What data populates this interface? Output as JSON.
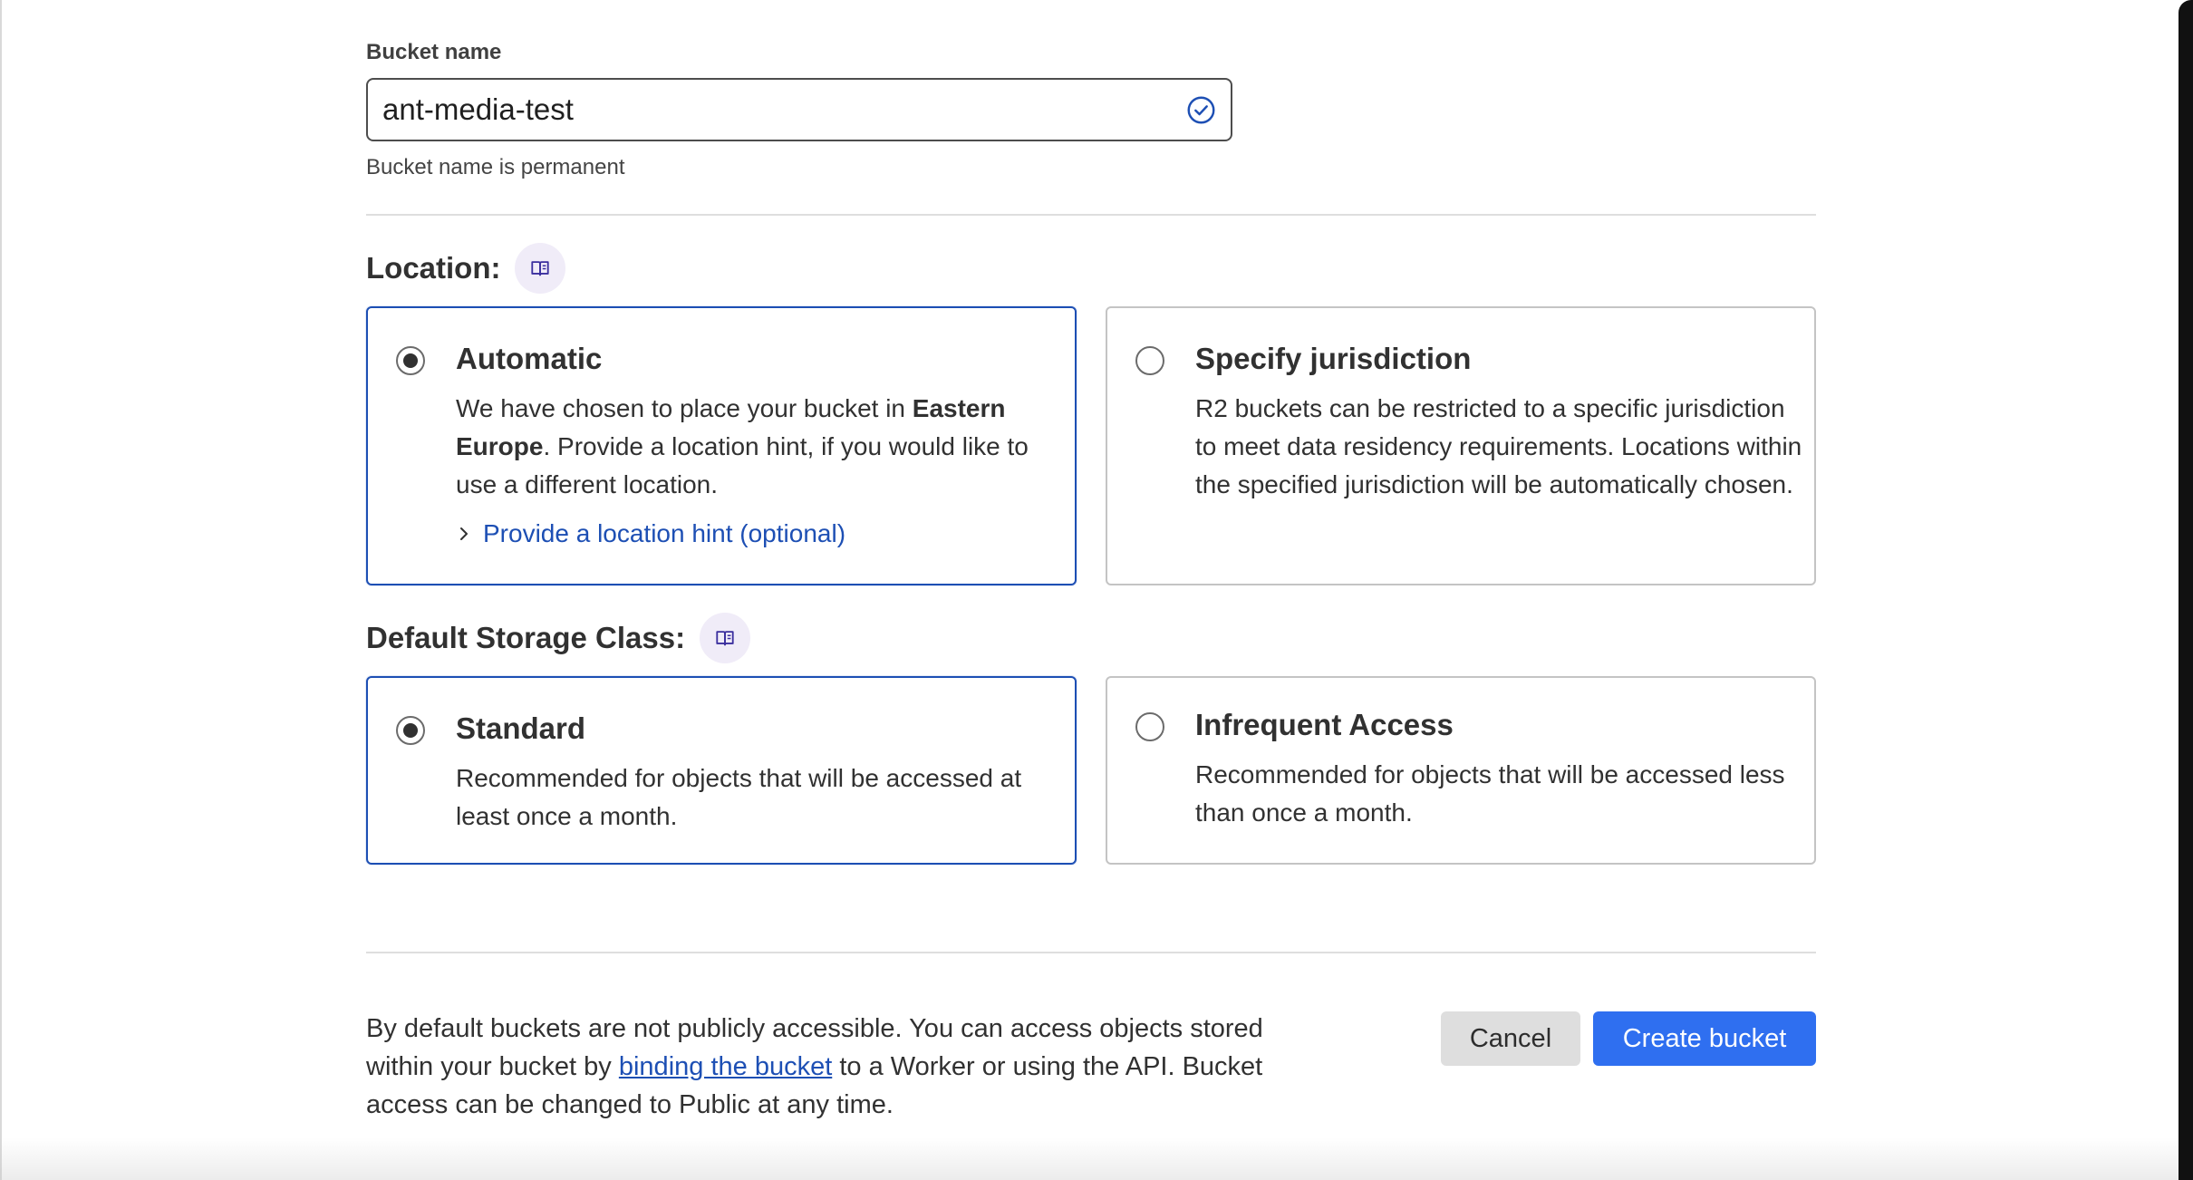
{
  "bucket_name": {
    "label": "Bucket name",
    "value": "ant-media-test",
    "helper": "Bucket name is permanent",
    "valid_icon": "check-circle-icon"
  },
  "location": {
    "title": "Location:",
    "docs_icon": "book-icon",
    "options": [
      {
        "title": "Automatic",
        "selected": true,
        "desc_before": "We have chosen to place your bucket in ",
        "desc_bold": "Eastern Europe",
        "desc_after": ". Provide a location hint, if you would like to use a different location.",
        "hint_link": "Provide a location hint (optional)"
      },
      {
        "title": "Specify jurisdiction",
        "selected": false,
        "desc": "R2 buckets can be restricted to a specific jurisdiction to meet data residency requirements. Locations within the specified jurisdiction will be automatically chosen."
      }
    ]
  },
  "storage_class": {
    "title": "Default Storage Class:",
    "docs_icon": "book-icon",
    "options": [
      {
        "title": "Standard",
        "selected": true,
        "desc": "Recommended for objects that will be accessed at least once a month."
      },
      {
        "title": "Infrequent Access",
        "selected": false,
        "desc": "Recommended for objects that will be accessed less than once a month."
      }
    ]
  },
  "footer": {
    "text_before": "By default buckets are not publicly accessible. You can access objects stored within your bucket by ",
    "link": "binding the bucket",
    "text_after": " to a Worker or using the API. Bucket access can be changed to Public at any time.",
    "cancel_label": "Cancel",
    "create_label": "Create bucket"
  },
  "colors": {
    "accent": "#1d4fb4",
    "primary_button": "#2f6ff0",
    "secondary_button": "#dedede"
  }
}
